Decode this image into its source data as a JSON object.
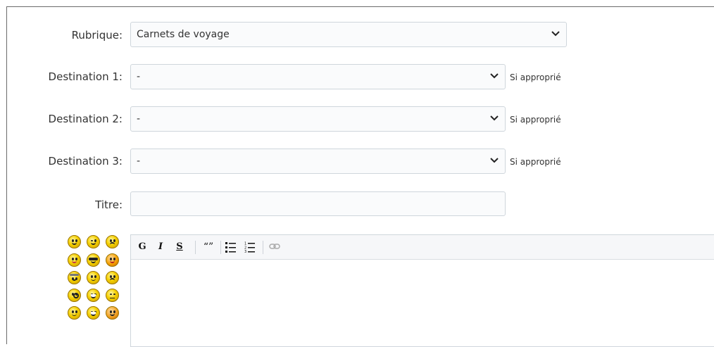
{
  "form": {
    "rubrique": {
      "label": "Rubrique:",
      "value": "Carnets de voyage"
    },
    "destinations": [
      {
        "label": "Destination 1:",
        "value": "-",
        "hint": "Si approprié"
      },
      {
        "label": "Destination 2:",
        "value": "-",
        "hint": "Si approprié"
      },
      {
        "label": "Destination 3:",
        "value": "-",
        "hint": "Si approprié"
      }
    ],
    "titre": {
      "label": "Titre:",
      "value": ""
    }
  },
  "editor": {
    "toolbar": {
      "bold": "G",
      "italic": "I",
      "strike": "S",
      "quote": "“”"
    },
    "icons": [
      "bold-icon",
      "italic-icon",
      "strikethrough-icon",
      "quote-icon",
      "bullet-list-icon",
      "numbered-list-icon",
      "link-icon"
    ]
  },
  "smileys": [
    "smiley-happy",
    "smiley-wink",
    "smiley-sad",
    "smiley-tongue",
    "smiley-cool",
    "smiley-angry",
    "smiley-angel",
    "smiley-confused",
    "smiley-mad",
    "smiley-surprised",
    "smiley-grin",
    "smiley-sleepy",
    "smiley-smile",
    "smiley-laugh",
    "smiley-blush"
  ]
}
